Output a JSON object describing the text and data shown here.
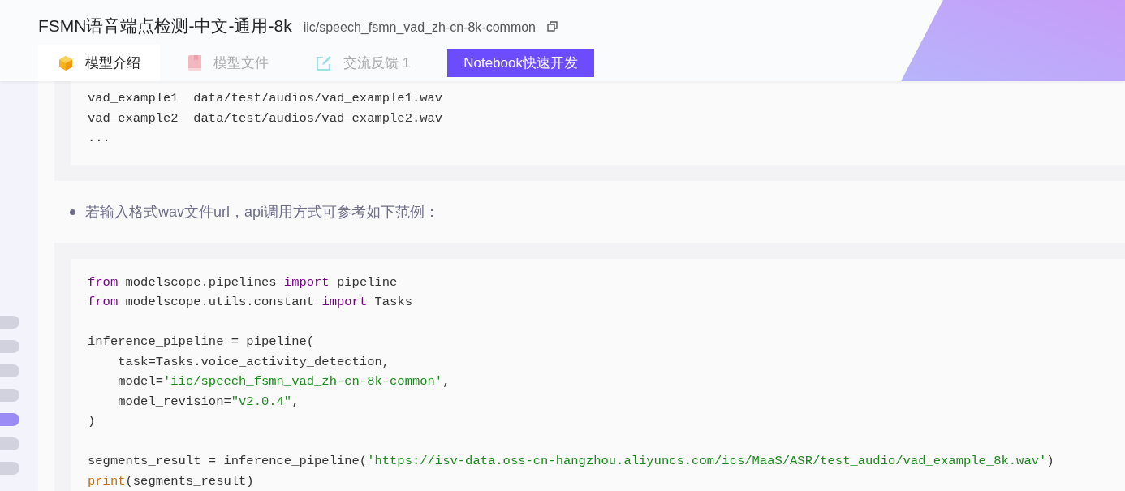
{
  "header": {
    "title": "FSMN语音端点检测-中文-通用-8k",
    "model_id": "iic/speech_fsmn_vad_zh-cn-8k-common",
    "tabs": [
      {
        "label": "模型介绍",
        "kind": "cube",
        "selected": true
      },
      {
        "label": "模型文件",
        "kind": "book",
        "selected": false
      },
      {
        "label": "交流反馈 1",
        "kind": "edit",
        "selected": false
      }
    ],
    "action_button": "Notebook快速开发"
  },
  "section_nav": [
    {
      "selected": false
    },
    {
      "selected": false
    },
    {
      "selected": false
    },
    {
      "selected": false
    },
    {
      "selected": true
    },
    {
      "selected": false
    },
    {
      "selected": false
    }
  ],
  "content": [
    {
      "kind": "code",
      "lines": [
        {
          "kind": "code",
          "tokens": [
            {
              "kind": "plain",
              "text": "vad_example1  data/test/audios/vad_example1.wav"
            }
          ]
        },
        {
          "kind": "code",
          "tokens": [
            {
              "kind": "plain",
              "text": "vad_example2  data/test/audios/vad_example2.wav"
            }
          ]
        },
        {
          "kind": "code",
          "tokens": [
            {
              "kind": "plain",
              "text": "..."
            }
          ]
        }
      ]
    },
    {
      "kind": "bullet",
      "text": "若输入格式wav文件url，api调用方式可参考如下范例："
    },
    {
      "kind": "code",
      "lines": [
        {
          "kind": "code",
          "tokens": [
            {
              "kind": "keyword",
              "text": "from"
            },
            {
              "kind": "plain",
              "text": " modelscope.pipelines "
            },
            {
              "kind": "keyword",
              "text": "import"
            },
            {
              "kind": "plain",
              "text": " pipeline"
            }
          ]
        },
        {
          "kind": "code",
          "tokens": [
            {
              "kind": "keyword",
              "text": "from"
            },
            {
              "kind": "plain",
              "text": " modelscope.utils.constant "
            },
            {
              "kind": "keyword",
              "text": "import"
            },
            {
              "kind": "plain",
              "text": " Tasks"
            }
          ]
        },
        {
          "kind": "blank"
        },
        {
          "kind": "code",
          "tokens": [
            {
              "kind": "plain",
              "text": "inference_pipeline = pipeline("
            }
          ]
        },
        {
          "kind": "code",
          "tokens": [
            {
              "kind": "plain",
              "text": "    task=Tasks.voice_activity_detection,"
            }
          ]
        },
        {
          "kind": "code",
          "tokens": [
            {
              "kind": "plain",
              "text": "    model="
            },
            {
              "kind": "string",
              "text": "'iic/speech_fsmn_vad_zh-cn-8k-common'"
            },
            {
              "kind": "plain",
              "text": ","
            }
          ]
        },
        {
          "kind": "code",
          "tokens": [
            {
              "kind": "plain",
              "text": "    model_revision="
            },
            {
              "kind": "string",
              "text": "\"v2.0.4\""
            },
            {
              "kind": "plain",
              "text": ","
            }
          ]
        },
        {
          "kind": "code",
          "tokens": [
            {
              "kind": "plain",
              "text": ")"
            }
          ]
        },
        {
          "kind": "blank"
        },
        {
          "kind": "code",
          "tokens": [
            {
              "kind": "plain",
              "text": "segments_result = inference_pipeline("
            },
            {
              "kind": "string",
              "text": "'https://isv-data.oss-cn-hangzhou.aliyuncs.com/ics/MaaS/ASR/test_audio/vad_example_8k.wav'"
            },
            {
              "kind": "plain",
              "text": ")"
            }
          ]
        },
        {
          "kind": "code",
          "tokens": [
            {
              "kind": "builtin",
              "text": "print"
            },
            {
              "kind": "plain",
              "text": "(segments_result)"
            }
          ]
        }
      ]
    }
  ]
}
